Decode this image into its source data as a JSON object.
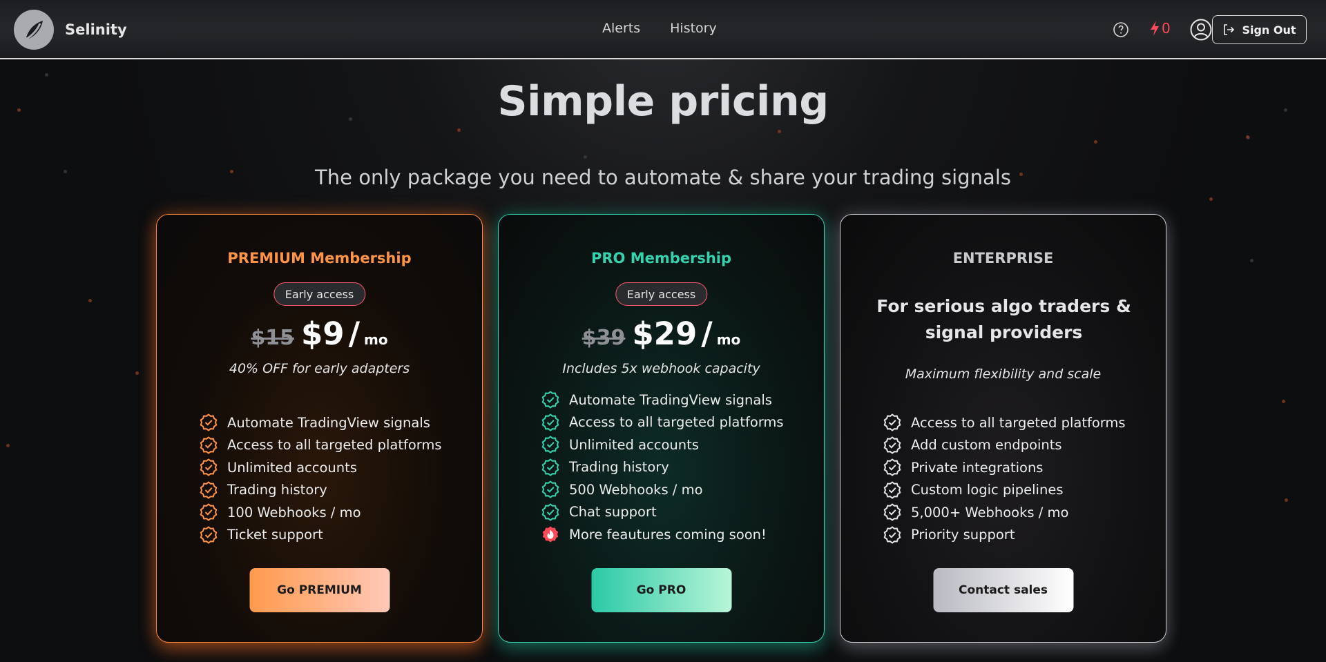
{
  "header": {
    "brand": "Selinity",
    "nav": [
      "Alerts",
      "History"
    ],
    "alert_count": "0",
    "sign_out": "Sign Out",
    "alert_color": "#ff4a5a"
  },
  "hero": {
    "title": "Simple pricing",
    "subtitle": "The only package you need to automate & share your trading signals"
  },
  "plans": [
    {
      "title": "PREMIUM Membership",
      "badge": "Early access",
      "old_price": "$15",
      "price": "$9",
      "slash": "/",
      "period": "mo",
      "tagline": "40% OFF for early adapters",
      "features": [
        "Automate TradingView signals",
        "Access to all targeted platforms",
        "Unlimited accounts",
        "Trading history",
        "100 Webhooks / mo",
        "Ticket support"
      ],
      "cta": "Go PREMIUM",
      "accent": "#ff9446"
    },
    {
      "title": "PRO Membership",
      "badge": "Early access",
      "old_price": "$39",
      "price": "$29",
      "slash": "/",
      "period": "mo",
      "tagline": "Includes 5x webhook capacity",
      "features": [
        "Automate TradingView signals",
        "Access to all targeted platforms",
        "Unlimited accounts",
        "Trading history",
        "500 Webhooks / mo",
        "Chat support",
        "More feautures coming soon!"
      ],
      "cta": "Go PRO",
      "accent": "#35d3ad"
    },
    {
      "title": "ENTERPRISE",
      "headline": "For serious algo traders & signal providers",
      "tagline": "Maximum flexibility and scale",
      "features": [
        "Access to all targeted platforms",
        "Add custom endpoints",
        "Private integrations",
        "Custom logic pipelines",
        "5,000+ Webhooks / mo",
        "Priority support"
      ],
      "cta": "Contact sales",
      "accent": "#e6e6e8"
    }
  ]
}
